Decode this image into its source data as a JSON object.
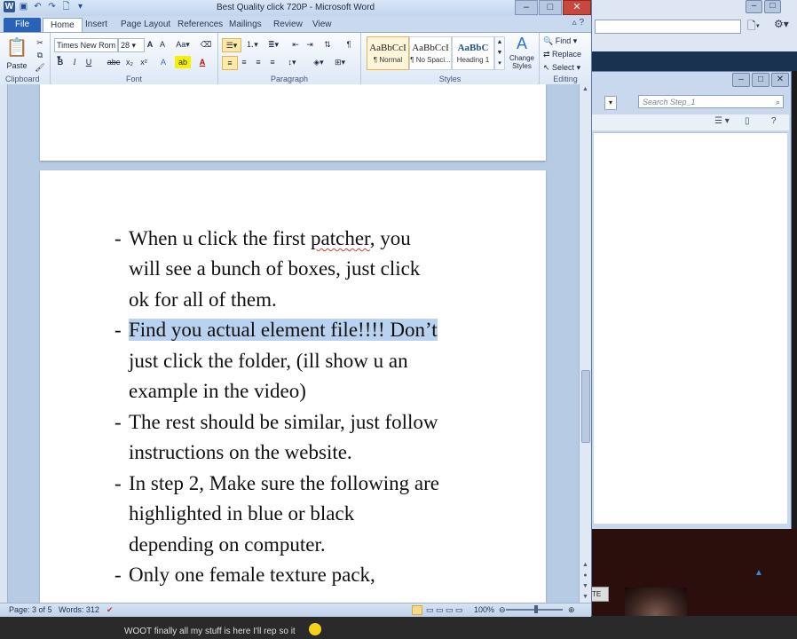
{
  "word": {
    "title": "Best Quality click 720P  -  Microsoft Word",
    "window_controls": [
      "–",
      "□",
      "✕"
    ],
    "tabs": [
      "File",
      "Home",
      "Insert",
      "Page Layout",
      "References",
      "Mailings",
      "Review",
      "View"
    ],
    "active_tab": "Home",
    "ribbon": {
      "clipboard": {
        "paste_label": "Paste",
        "group_label": "Clipboard"
      },
      "font": {
        "font_name": "Times New Rom",
        "font_size": "28",
        "bold": "B",
        "italic": "I",
        "underline": "U",
        "strike": "abc",
        "subscript": "x₂",
        "superscript": "x²",
        "group_label": "Font"
      },
      "paragraph": {
        "group_label": "Paragraph"
      },
      "styles": {
        "items": [
          {
            "preview": "AaBbCcI",
            "name": "¶ Normal"
          },
          {
            "preview": "AaBbCcI",
            "name": "¶ No Spaci..."
          },
          {
            "preview": "AaBbC",
            "name": "Heading 1"
          }
        ],
        "change_styles_label": "Change Styles",
        "group_label": "Styles"
      },
      "editing": {
        "find": "Find",
        "replace": "Replace",
        "select": "Select",
        "group_label": "Editing"
      }
    },
    "document": {
      "bullet_char": "-",
      "lines": [
        {
          "pre": "When u click the first ",
          "spell": "patcher",
          "post": ", you",
          "bullet": true
        },
        {
          "text": "will see a bunch of boxes, just click"
        },
        {
          "text": "ok for all of them."
        },
        {
          "highlight": "Find you actual element file!!!! Don’t",
          "bullet": true
        },
        {
          "text": "just click the folder, (ill show u an"
        },
        {
          "text": "example in the video)"
        },
        {
          "text": "The rest should be similar, just follow",
          "bullet": true
        },
        {
          "text": "instructions on the website."
        },
        {
          "text": "In step 2, Make sure the following are",
          "bullet": true
        },
        {
          "text": "highlighted in blue or black"
        },
        {
          "text": "depending on computer."
        },
        {
          "text": "Only one female texture pack,",
          "bullet": true
        }
      ]
    },
    "status": {
      "page": "Page: 3 of 5",
      "words": "Words: 312",
      "zoom": "100%"
    }
  },
  "background": {
    "explorer_search_placeholder": "Search Step_1",
    "bottom_text": "WOOT finally all my stuff is here I'll rep so it"
  }
}
